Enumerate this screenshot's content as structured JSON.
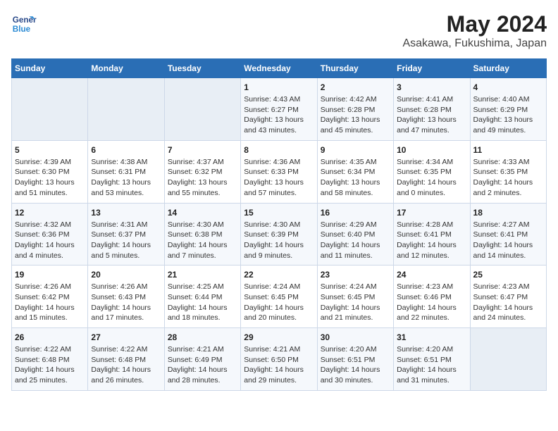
{
  "header": {
    "logo_line1": "General",
    "logo_line2": "Blue",
    "title": "May 2024",
    "subtitle": "Asakawa, Fukushima, Japan"
  },
  "days_of_week": [
    "Sunday",
    "Monday",
    "Tuesday",
    "Wednesday",
    "Thursday",
    "Friday",
    "Saturday"
  ],
  "weeks": [
    [
      {
        "day": "",
        "info": ""
      },
      {
        "day": "",
        "info": ""
      },
      {
        "day": "",
        "info": ""
      },
      {
        "day": "1",
        "info": "Sunrise: 4:43 AM\nSunset: 6:27 PM\nDaylight: 13 hours\nand 43 minutes."
      },
      {
        "day": "2",
        "info": "Sunrise: 4:42 AM\nSunset: 6:28 PM\nDaylight: 13 hours\nand 45 minutes."
      },
      {
        "day": "3",
        "info": "Sunrise: 4:41 AM\nSunset: 6:28 PM\nDaylight: 13 hours\nand 47 minutes."
      },
      {
        "day": "4",
        "info": "Sunrise: 4:40 AM\nSunset: 6:29 PM\nDaylight: 13 hours\nand 49 minutes."
      }
    ],
    [
      {
        "day": "5",
        "info": "Sunrise: 4:39 AM\nSunset: 6:30 PM\nDaylight: 13 hours\nand 51 minutes."
      },
      {
        "day": "6",
        "info": "Sunrise: 4:38 AM\nSunset: 6:31 PM\nDaylight: 13 hours\nand 53 minutes."
      },
      {
        "day": "7",
        "info": "Sunrise: 4:37 AM\nSunset: 6:32 PM\nDaylight: 13 hours\nand 55 minutes."
      },
      {
        "day": "8",
        "info": "Sunrise: 4:36 AM\nSunset: 6:33 PM\nDaylight: 13 hours\nand 57 minutes."
      },
      {
        "day": "9",
        "info": "Sunrise: 4:35 AM\nSunset: 6:34 PM\nDaylight: 13 hours\nand 58 minutes."
      },
      {
        "day": "10",
        "info": "Sunrise: 4:34 AM\nSunset: 6:35 PM\nDaylight: 14 hours\nand 0 minutes."
      },
      {
        "day": "11",
        "info": "Sunrise: 4:33 AM\nSunset: 6:35 PM\nDaylight: 14 hours\nand 2 minutes."
      }
    ],
    [
      {
        "day": "12",
        "info": "Sunrise: 4:32 AM\nSunset: 6:36 PM\nDaylight: 14 hours\nand 4 minutes."
      },
      {
        "day": "13",
        "info": "Sunrise: 4:31 AM\nSunset: 6:37 PM\nDaylight: 14 hours\nand 5 minutes."
      },
      {
        "day": "14",
        "info": "Sunrise: 4:30 AM\nSunset: 6:38 PM\nDaylight: 14 hours\nand 7 minutes."
      },
      {
        "day": "15",
        "info": "Sunrise: 4:30 AM\nSunset: 6:39 PM\nDaylight: 14 hours\nand 9 minutes."
      },
      {
        "day": "16",
        "info": "Sunrise: 4:29 AM\nSunset: 6:40 PM\nDaylight: 14 hours\nand 11 minutes."
      },
      {
        "day": "17",
        "info": "Sunrise: 4:28 AM\nSunset: 6:41 PM\nDaylight: 14 hours\nand 12 minutes."
      },
      {
        "day": "18",
        "info": "Sunrise: 4:27 AM\nSunset: 6:41 PM\nDaylight: 14 hours\nand 14 minutes."
      }
    ],
    [
      {
        "day": "19",
        "info": "Sunrise: 4:26 AM\nSunset: 6:42 PM\nDaylight: 14 hours\nand 15 minutes."
      },
      {
        "day": "20",
        "info": "Sunrise: 4:26 AM\nSunset: 6:43 PM\nDaylight: 14 hours\nand 17 minutes."
      },
      {
        "day": "21",
        "info": "Sunrise: 4:25 AM\nSunset: 6:44 PM\nDaylight: 14 hours\nand 18 minutes."
      },
      {
        "day": "22",
        "info": "Sunrise: 4:24 AM\nSunset: 6:45 PM\nDaylight: 14 hours\nand 20 minutes."
      },
      {
        "day": "23",
        "info": "Sunrise: 4:24 AM\nSunset: 6:45 PM\nDaylight: 14 hours\nand 21 minutes."
      },
      {
        "day": "24",
        "info": "Sunrise: 4:23 AM\nSunset: 6:46 PM\nDaylight: 14 hours\nand 22 minutes."
      },
      {
        "day": "25",
        "info": "Sunrise: 4:23 AM\nSunset: 6:47 PM\nDaylight: 14 hours\nand 24 minutes."
      }
    ],
    [
      {
        "day": "26",
        "info": "Sunrise: 4:22 AM\nSunset: 6:48 PM\nDaylight: 14 hours\nand 25 minutes."
      },
      {
        "day": "27",
        "info": "Sunrise: 4:22 AM\nSunset: 6:48 PM\nDaylight: 14 hours\nand 26 minutes."
      },
      {
        "day": "28",
        "info": "Sunrise: 4:21 AM\nSunset: 6:49 PM\nDaylight: 14 hours\nand 28 minutes."
      },
      {
        "day": "29",
        "info": "Sunrise: 4:21 AM\nSunset: 6:50 PM\nDaylight: 14 hours\nand 29 minutes."
      },
      {
        "day": "30",
        "info": "Sunrise: 4:20 AM\nSunset: 6:51 PM\nDaylight: 14 hours\nand 30 minutes."
      },
      {
        "day": "31",
        "info": "Sunrise: 4:20 AM\nSunset: 6:51 PM\nDaylight: 14 hours\nand 31 minutes."
      },
      {
        "day": "",
        "info": ""
      }
    ]
  ]
}
